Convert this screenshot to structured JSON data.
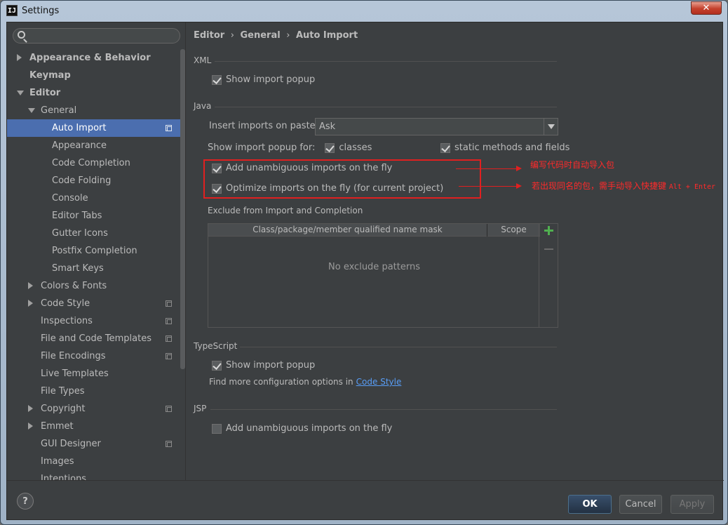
{
  "window": {
    "title": "Settings",
    "app_icon": "IJ",
    "close_label": "✕"
  },
  "search": {
    "placeholder": ""
  },
  "tree": [
    {
      "label": "Appearance & Behavior",
      "bold": true,
      "arrow": "right"
    },
    {
      "label": "Keymap",
      "bold": true
    },
    {
      "label": "Editor",
      "bold": true,
      "arrow": "down"
    },
    {
      "label": "General",
      "arrow": "down"
    },
    {
      "label": "Auto Import",
      "selected": true,
      "project": true
    },
    {
      "label": "Appearance"
    },
    {
      "label": "Code Completion"
    },
    {
      "label": "Code Folding"
    },
    {
      "label": "Console"
    },
    {
      "label": "Editor Tabs"
    },
    {
      "label": "Gutter Icons"
    },
    {
      "label": "Postfix Completion"
    },
    {
      "label": "Smart Keys"
    },
    {
      "label": "Colors & Fonts",
      "arrow": "right"
    },
    {
      "label": "Code Style",
      "arrow": "right",
      "project": true
    },
    {
      "label": "Inspections",
      "project": true
    },
    {
      "label": "File and Code Templates",
      "project": true
    },
    {
      "label": "File Encodings",
      "project": true
    },
    {
      "label": "Live Templates"
    },
    {
      "label": "File Types"
    },
    {
      "label": "Copyright",
      "arrow": "right",
      "project": true
    },
    {
      "label": "Emmet",
      "arrow": "right"
    },
    {
      "label": "GUI Designer",
      "project": true
    },
    {
      "label": "Images"
    },
    {
      "label": "Intentions"
    }
  ],
  "breadcrumb": {
    "part1": "Editor",
    "part2": "General",
    "part3": "Auto Import",
    "sep": "›"
  },
  "xml": {
    "title": "XML",
    "show_popup": "Show import popup"
  },
  "java": {
    "title": "Java",
    "insert_label": "Insert imports on paste:",
    "insert_value": "Ask",
    "show_popup_for": "Show import popup for:",
    "classes": "classes",
    "static": "static methods and fields",
    "add_unambiguous": "Add unambiguous imports on the fly",
    "optimize": "Optimize imports on the fly (for current project)"
  },
  "annotations": {
    "note1": "编写代码时自动导入包",
    "note2_prefix": "若出现同名的包，需手动导入快捷键 ",
    "note2_keys": "Alt + Enter"
  },
  "exclude": {
    "title": "Exclude from Import and Completion",
    "col1": "Class/package/member qualified name mask",
    "col2": "Scope",
    "empty": "No exclude patterns"
  },
  "typescript": {
    "title": "TypeScript",
    "show_popup": "Show import popup",
    "find_more": "Find more configuration options in ",
    "link": "Code Style"
  },
  "jsp": {
    "title": "JSP",
    "add_unambiguous": "Add unambiguous imports on the fly"
  },
  "footer": {
    "help": "?",
    "ok": "OK",
    "cancel": "Cancel",
    "apply": "Apply"
  }
}
